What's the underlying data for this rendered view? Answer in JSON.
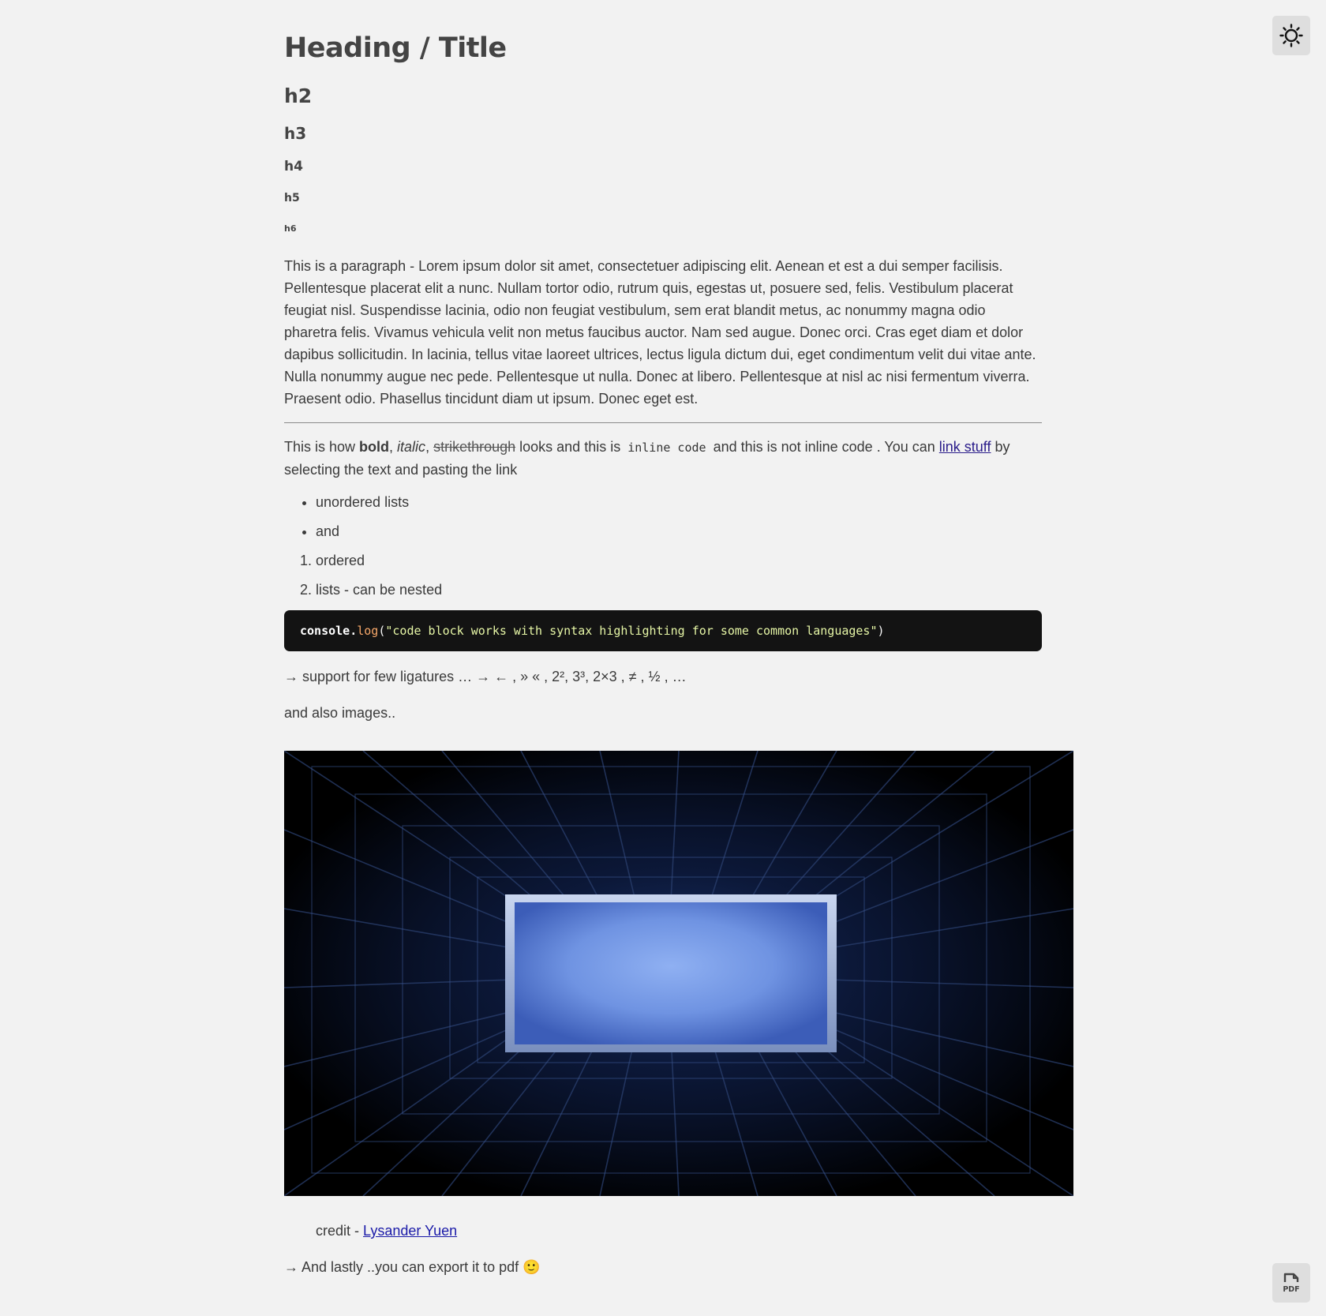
{
  "headings": {
    "h1": "Heading / Title",
    "h2": "h2",
    "h3": "h3",
    "h4": "h4",
    "h5": "h5",
    "h6": "h6"
  },
  "paragraph": "This is a paragraph - Lorem ipsum dolor sit amet, consectetuer adipiscing elit. Aenean et est a dui semper facilisis. Pellentesque placerat elit a nunc. Nullam tortor odio, rutrum quis, egestas ut, posuere sed, felis. Vestibulum placerat feugiat nisl. Suspendisse lacinia, odio non feugiat vestibulum, sem erat blandit metus, ac nonummy magna odio pharetra felis. Vivamus vehicula velit non metus faucibus auctor. Nam sed augue. Donec orci. Cras eget diam et dolor dapibus sollicitudin. In lacinia, tellus vitae laoreet ultrices, lectus ligula dictum dui, eget condimentum velit dui vitae ante. Nulla nonummy augue nec pede. Pellentesque ut nulla. Donec at libero. Pellentesque at nisl ac nisi fermentum viverra. Praesent odio. Phasellus tincidunt diam ut ipsum. Donec eget est.",
  "formatting": {
    "t1": "This is how ",
    "bold": "bold",
    "t2": ", ",
    "italic": "italic",
    "t3": ", ",
    "strike": "strikethrough",
    "t4": " looks and this is ",
    "code": "inline code",
    "t5": " and this is not inline code . You can ",
    "link": "link stuff",
    "t6": " by selecting the text and pasting the link"
  },
  "unordered_list": [
    "unordered lists",
    "and"
  ],
  "ordered_list": [
    "ordered",
    "lists - can be nested"
  ],
  "code_block": {
    "obj": "console",
    "dot": ".",
    "fn": "log",
    "open": "(",
    "str": "\"code block works with syntax highlighting for some common languages\"",
    "close": ")"
  },
  "ligatures": "→ support for few ligatures … → ← , » « , 2², 3³, 2×3 , ≠ , ½ , …",
  "also_images": "and also images..",
  "credit": {
    "prefix": "credit - ",
    "author": "Lysander Yuen"
  },
  "lastly": {
    "text": "→ And lastly ..you can export it to pdf ",
    "emoji": "🙂"
  },
  "buttons": {
    "theme_icon": "sun-icon",
    "pdf_icon": "pdf-icon",
    "pdf_label": "PDF"
  },
  "colors": {
    "background": "#f2f2f2",
    "code_bg": "#131313",
    "link": "#2a1c8a"
  }
}
